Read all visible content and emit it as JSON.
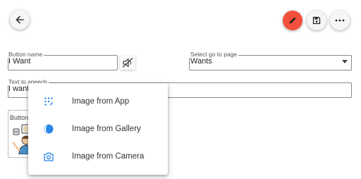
{
  "toolbar": {
    "back_icon": "arrow-left-icon",
    "edit_icon": "pencil-icon",
    "save_icon": "save-icon",
    "more_icon": "more-horizontal-icon",
    "edit_color": "#f24f3d"
  },
  "button_name": {
    "label": "Button name",
    "value": "I Want"
  },
  "mute_icon": "volume-off-icon",
  "go_to_page": {
    "label": "Select go to page",
    "value": "Wants"
  },
  "text_to_speech": {
    "label": "Text to speech",
    "value": "I want"
  },
  "button_image": {
    "label": "Button image"
  },
  "image_menu": {
    "accent_color": "#2b87e8",
    "items": [
      {
        "label": "Image from App",
        "icon": "apps-icon"
      },
      {
        "label": "Image from Gallery",
        "icon": "gallery-icon"
      },
      {
        "label": "Image from Camera",
        "icon": "camera-icon"
      }
    ]
  }
}
